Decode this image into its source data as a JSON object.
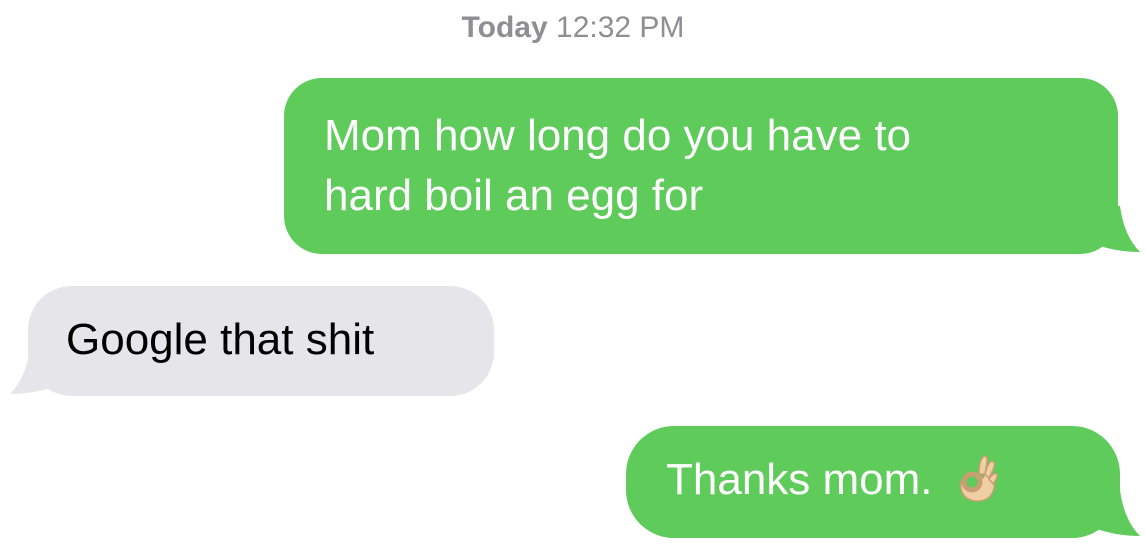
{
  "conversation": {
    "timestamp": {
      "day": "Today",
      "time": "12:32 PM"
    },
    "messages": [
      {
        "direction": "sent",
        "line1": "Mom how long do you have to",
        "line2": "hard boil an egg for"
      },
      {
        "direction": "received",
        "text": "Google that shit"
      },
      {
        "direction": "sent",
        "text": "Thanks mom.",
        "emoji": "ok-hand-emoji-icon"
      }
    ]
  },
  "colors": {
    "sent_bubble": "#5ecb5b",
    "received_bubble": "#e5e5ea",
    "timestamp_text": "#8e8e93"
  }
}
